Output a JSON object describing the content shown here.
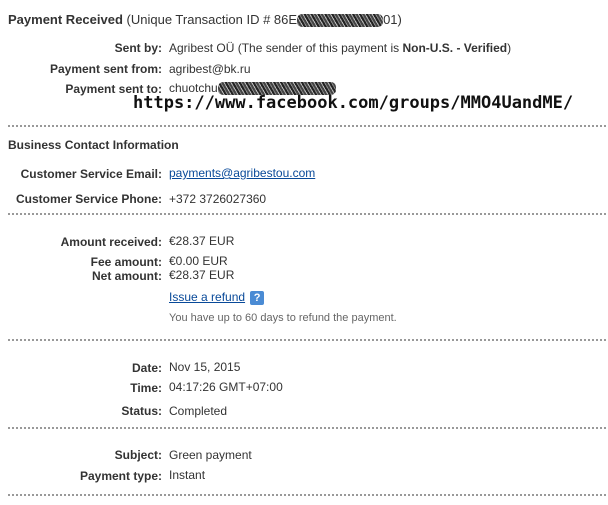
{
  "header": {
    "title": "Payment Received",
    "subtitle_prefix": "(Unique Transaction ID # 86E",
    "subtitle_suffix": "01)"
  },
  "sender": {
    "sent_by_label": "Sent by:",
    "sent_by_name": "Agribest OÜ",
    "sent_by_note_prefix": "(The sender of this payment is ",
    "sent_by_status": "Non-U.S. - Verified",
    "sent_by_note_suffix": ")",
    "sent_from_label": "Payment sent from:",
    "sent_from_value": "agribest@bk.ru",
    "sent_to_label": "Payment sent to:",
    "sent_to_value": "chuotchu"
  },
  "watermark": "https://www.facebook.com/groups/MMO4UandME/",
  "business": {
    "heading": "Business Contact Information",
    "email_label": "Customer Service Email:",
    "email_value": "payments@agribestou.com",
    "phone_label": "Customer Service Phone:",
    "phone_value": "+372 3726027360"
  },
  "amounts": {
    "received_label": "Amount received:",
    "received_value": "€28.37 EUR",
    "fee_label": "Fee amount:",
    "fee_value": "€0.00 EUR",
    "net_label": "Net amount:",
    "net_value": "€28.37 EUR",
    "refund_link": "Issue a refund",
    "help_icon": "?",
    "refund_note": "You have up to 60 days to refund the payment."
  },
  "details": {
    "date_label": "Date:",
    "date_value": "Nov 15, 2015",
    "time_label": "Time:",
    "time_value": "04:17:26 GMT+07:00",
    "status_label": "Status:",
    "status_value": "Completed"
  },
  "subject": {
    "subject_label": "Subject:",
    "subject_value": "Green payment",
    "type_label": "Payment type:",
    "type_value": "Instant"
  },
  "colors": {
    "link": "#084999",
    "separator": "#999999",
    "help_icon_bg": "#4a8bd4"
  },
  "icons": {
    "help": "help-icon"
  }
}
